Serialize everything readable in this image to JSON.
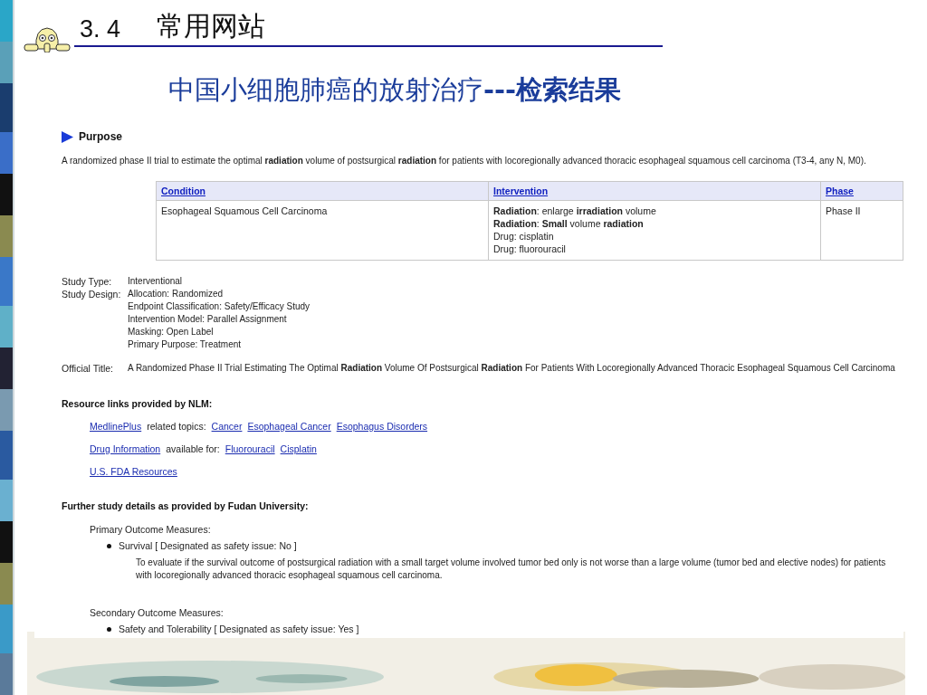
{
  "slide": {
    "section_number": "3. 4",
    "section_title": "常用网站",
    "heading": "中国小细胞肺癌的放射治疗**---检索结果**"
  },
  "page": {
    "purpose_heading": "Purpose",
    "purpose_text": "A randomized phase II trial to estimate the optimal **radiation** volume of postsurgical **radiation** for patients with locoregionally advanced thoracic esophageal squamous cell carcinoma (T3-4, any N, M0).",
    "table": {
      "columns": [
        "Condition",
        "Intervention",
        "Phase"
      ],
      "rows": [
        [
          [
            "Esophageal Squamous Cell Carcinoma"
          ],
          [
            "**Radiation**: enlarge **irradiation** volume",
            "**Radiation**: **Small** volume **radiation**",
            "Drug: cisplatin",
            "Drug: fluorouracil"
          ],
          [
            "Phase II"
          ]
        ]
      ]
    },
    "study_fields": [
      {
        "label": "Study Type:",
        "values": [
          "Interventional"
        ]
      },
      {
        "label": "Study Design:",
        "values": [
          "Allocation: Randomized",
          "Endpoint Classification: Safety/Efficacy Study",
          "Intervention Model: Parallel Assignment",
          "Masking: Open Label",
          "Primary Purpose: Treatment"
        ]
      },
      {
        "label": "Official Title:",
        "values": [
          "A Randomized Phase II Trial Estimating The Optimal **Radiation** Volume Of Postsurgical **Radiation** For Patients With Locoregionally Advanced Thoracic Esophageal Squamous Cell Carcinoma"
        ]
      }
    ],
    "resources_heading": "Resource links provided by NLM:",
    "resource_lines": [
      [
        {
          "kind": "link",
          "text": "MedlinePlus"
        },
        {
          "kind": "text",
          "text": "related topics:"
        },
        {
          "kind": "link",
          "text": "Cancer"
        },
        {
          "kind": "link",
          "text": "Esophageal Cancer"
        },
        {
          "kind": "link",
          "text": "Esophagus Disorders"
        }
      ],
      [
        {
          "kind": "link",
          "text": "Drug Information"
        },
        {
          "kind": "text",
          "text": "available for:"
        },
        {
          "kind": "link",
          "text": "Fluorouracil"
        },
        {
          "kind": "link",
          "text": "Cisplatin"
        }
      ],
      [
        {
          "kind": "link",
          "text": "U.S. FDA Resources"
        }
      ]
    ],
    "details_heading": "Further study details as provided by Fudan University:",
    "outcomes": [
      {
        "label": "Primary Outcome Measures:",
        "items": [
          {
            "title": "Survival [ Designated as safety issue: No ]",
            "description": "To evaluate if the survival outcome of postsurgical radiation with a small target volume involved tumor bed only is not worse than a large volume (tumor bed and elective nodes) for patients with locoregionally advanced thoracic esophageal squamous cell carcinoma."
          }
        ]
      },
      {
        "label": "Secondary Outcome Measures:",
        "items": [
          {
            "title": "Safety and Tolerability [ Designated as safety issue: Yes ]"
          }
        ]
      }
    ]
  }
}
